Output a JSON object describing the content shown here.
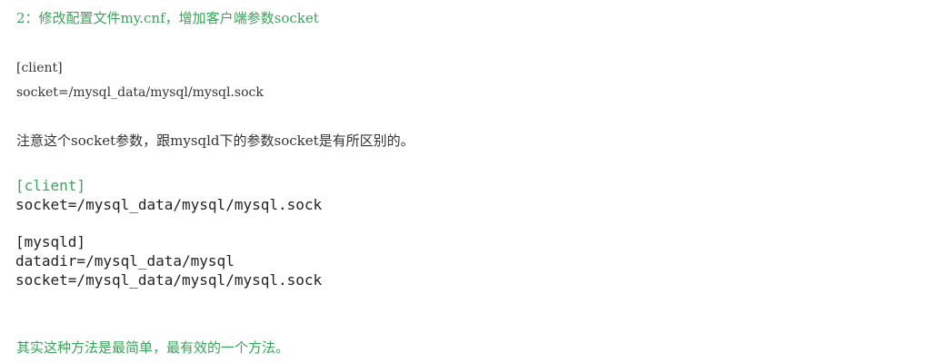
{
  "article": {
    "step_heading": "2：修改配置文件my.cnf，增加客户端参数socket",
    "config_lines": [
      "[client]",
      "socket=/mysql_data/mysql/mysql.sock"
    ],
    "note": "注意这个socket参数，跟mysqld下的参数socket是有所区别的。",
    "code_block": [
      "[client]",
      "socket=/mysql_data/mysql/mysql.sock",
      "",
      "[mysqld]",
      "datadir=/mysql_data/mysql",
      "socket=/mysql_data/mysql/mysql.sock"
    ],
    "conclusion": "其实这种方法是最简单，最有效的一个方法。"
  },
  "colors": {
    "accent_green": "#3aa35a",
    "body_text": "#333333",
    "code_text": "#222222",
    "background": "#ffffff"
  }
}
